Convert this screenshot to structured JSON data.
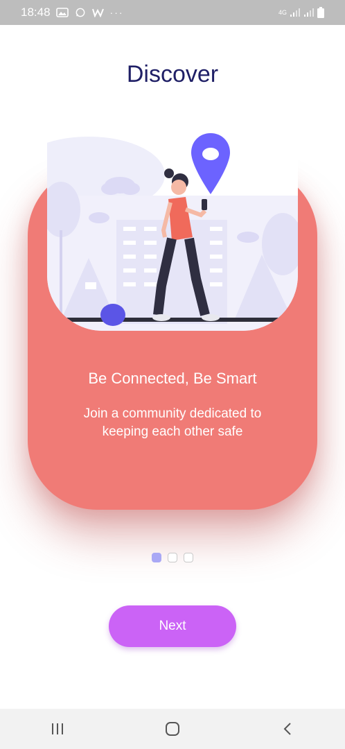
{
  "status_bar": {
    "time": "18:48",
    "more": "···",
    "network": "4G"
  },
  "page": {
    "title": "Discover"
  },
  "card": {
    "heading": "Be Connected, Be Smart",
    "body": "Join a community dedicated to keeping each other safe"
  },
  "pager": {
    "total": 3,
    "active_index": 0
  },
  "actions": {
    "next_label": "Next"
  },
  "colors": {
    "title": "#1f1f66",
    "card": "#f07b76",
    "button": "#cb63f6",
    "dot_active": "#a9a8f5",
    "pin": "#6c63ff"
  },
  "icons": {
    "nav_recent": "recent-apps-icon",
    "nav_home": "home-icon",
    "nav_back": "back-icon"
  }
}
